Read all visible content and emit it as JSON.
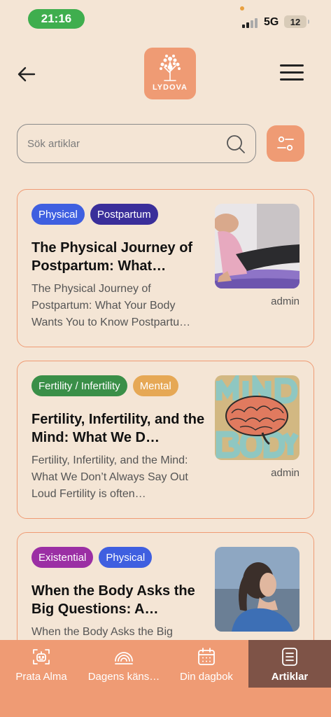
{
  "status": {
    "time": "21:16",
    "network": "5G",
    "battery": "12"
  },
  "header": {
    "logo_text": "LYDOVA"
  },
  "search": {
    "placeholder": "Sök artiklar"
  },
  "colors": {
    "background": "#f4e5d5",
    "accent": "#ef9b74",
    "nav_active": "#7e5347"
  },
  "articles": [
    {
      "tags": [
        {
          "label": "Physical",
          "color": "#3f5fe0"
        },
        {
          "label": "Postpartum",
          "color": "#3a2e9a"
        }
      ],
      "title": "The Physical Journey of Postpartum: What…",
      "excerpt": "The Physical Journey of Postpartum: What Your Body Wants You to Know Postpartu…",
      "author": "admin",
      "image": "woman-stretching-on-yoga-mat"
    },
    {
      "tags": [
        {
          "label": "Fertility / Infertility",
          "color": "#3a8f48"
        },
        {
          "label": "Mental",
          "color": "#e6a855"
        }
      ],
      "title": "Fertility, Infertility, and the Mind: What We D…",
      "excerpt": "Fertility, Infertility, and the Mind: What We Don’t Always Say Out Loud Fertility is often…",
      "author": "admin",
      "image": "brain-mind-body-illustration"
    },
    {
      "tags": [
        {
          "label": "Existential",
          "color": "#9b2fa4"
        },
        {
          "label": "Physical",
          "color": "#3f5fe0"
        }
      ],
      "title": "When the Body Asks the Big Questions: A…",
      "excerpt": "When the Body Asks the Big",
      "author": "",
      "image": "woman-with-ponytail-outdoors"
    }
  ],
  "nav": {
    "items": [
      {
        "label": "Prata Alma",
        "icon": "robot-icon"
      },
      {
        "label": "Dagens käns…",
        "icon": "mood-icon"
      },
      {
        "label": "Din dagbok",
        "icon": "calendar-icon"
      },
      {
        "label": "Artiklar",
        "icon": "article-icon",
        "active": true
      }
    ]
  }
}
